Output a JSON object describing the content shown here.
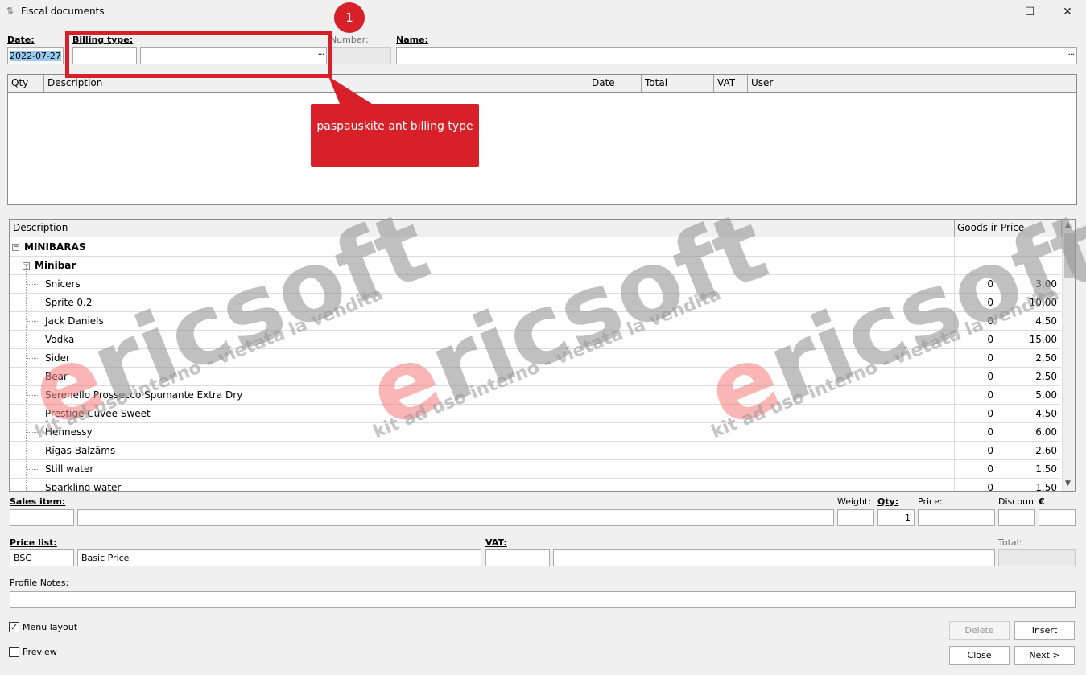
{
  "window": {
    "title": "Fiscal documents",
    "maximize_glyph": "☐",
    "close_glyph": "✕"
  },
  "header": {
    "date_label": "Date:",
    "date_value": "2022-07-27",
    "billing_type_label": "Billing type:",
    "billing_code": "",
    "billing_desc": "",
    "number_label": "Number:",
    "number_value": "",
    "name_label": "Name:",
    "name_value": "",
    "browse_glyph": "···"
  },
  "callout": {
    "badge": "1",
    "text": "paspauskite ant billing type"
  },
  "lines_grid": {
    "columns": [
      "Qty",
      "Description",
      "Date",
      "Total",
      "VAT",
      "User"
    ],
    "rows": []
  },
  "items_grid": {
    "columns": [
      "Description",
      "Goods in",
      "Price"
    ],
    "groups": [
      {
        "label": "MINIBARAS",
        "subgroup": "Minibar"
      }
    ],
    "rows": [
      {
        "desc": "Snicers",
        "goods": "0",
        "price": "3,00"
      },
      {
        "desc": "Sprite 0.2",
        "goods": "0",
        "price": "10,00"
      },
      {
        "desc": "Jack Daniels",
        "goods": "0",
        "price": "4,50"
      },
      {
        "desc": "Vodka",
        "goods": "0",
        "price": "15,00"
      },
      {
        "desc": "Sider",
        "goods": "0",
        "price": "2,50"
      },
      {
        "desc": "Bear",
        "goods": "0",
        "price": "2,50"
      },
      {
        "desc": "Serenello Prossecco Spumante Extra Dry",
        "goods": "0",
        "price": "5,00"
      },
      {
        "desc": "Prestige Cuvee Sweet",
        "goods": "0",
        "price": "4,50"
      },
      {
        "desc": "Hennessy",
        "goods": "0",
        "price": "6,00"
      },
      {
        "desc": "Rīgas Balzāms",
        "goods": "0",
        "price": "2,60"
      },
      {
        "desc": "Still water",
        "goods": "0",
        "price": "1,50"
      },
      {
        "desc": "Sparkling water",
        "goods": "0",
        "price": "1,50"
      }
    ]
  },
  "sales": {
    "sales_item_label": "Sales item:",
    "weight_label": "Weight:",
    "qty_label": "Qty:",
    "qty_value": "1",
    "price_label": "Price:",
    "discount_label": "Discoun",
    "currency_label": "€"
  },
  "pricing": {
    "price_list_label": "Price list:",
    "price_list_code": "BSC",
    "price_list_name": "Basic Price",
    "vat_label": "VAT:",
    "total_label": "Total:"
  },
  "profile": {
    "notes_label": "Profile Notes:"
  },
  "options": {
    "menu_layout_label": "Menu layout",
    "menu_layout_checked": true,
    "preview_label": "Preview",
    "preview_checked": false
  },
  "buttons": {
    "delete": "Delete",
    "insert": "Insert",
    "close": "Close",
    "next": "Next >"
  },
  "watermark": {
    "brand_first": "e",
    "brand_rest": "ricsoft",
    "tagline": "kit ad uso interno - vietata la vendita"
  }
}
